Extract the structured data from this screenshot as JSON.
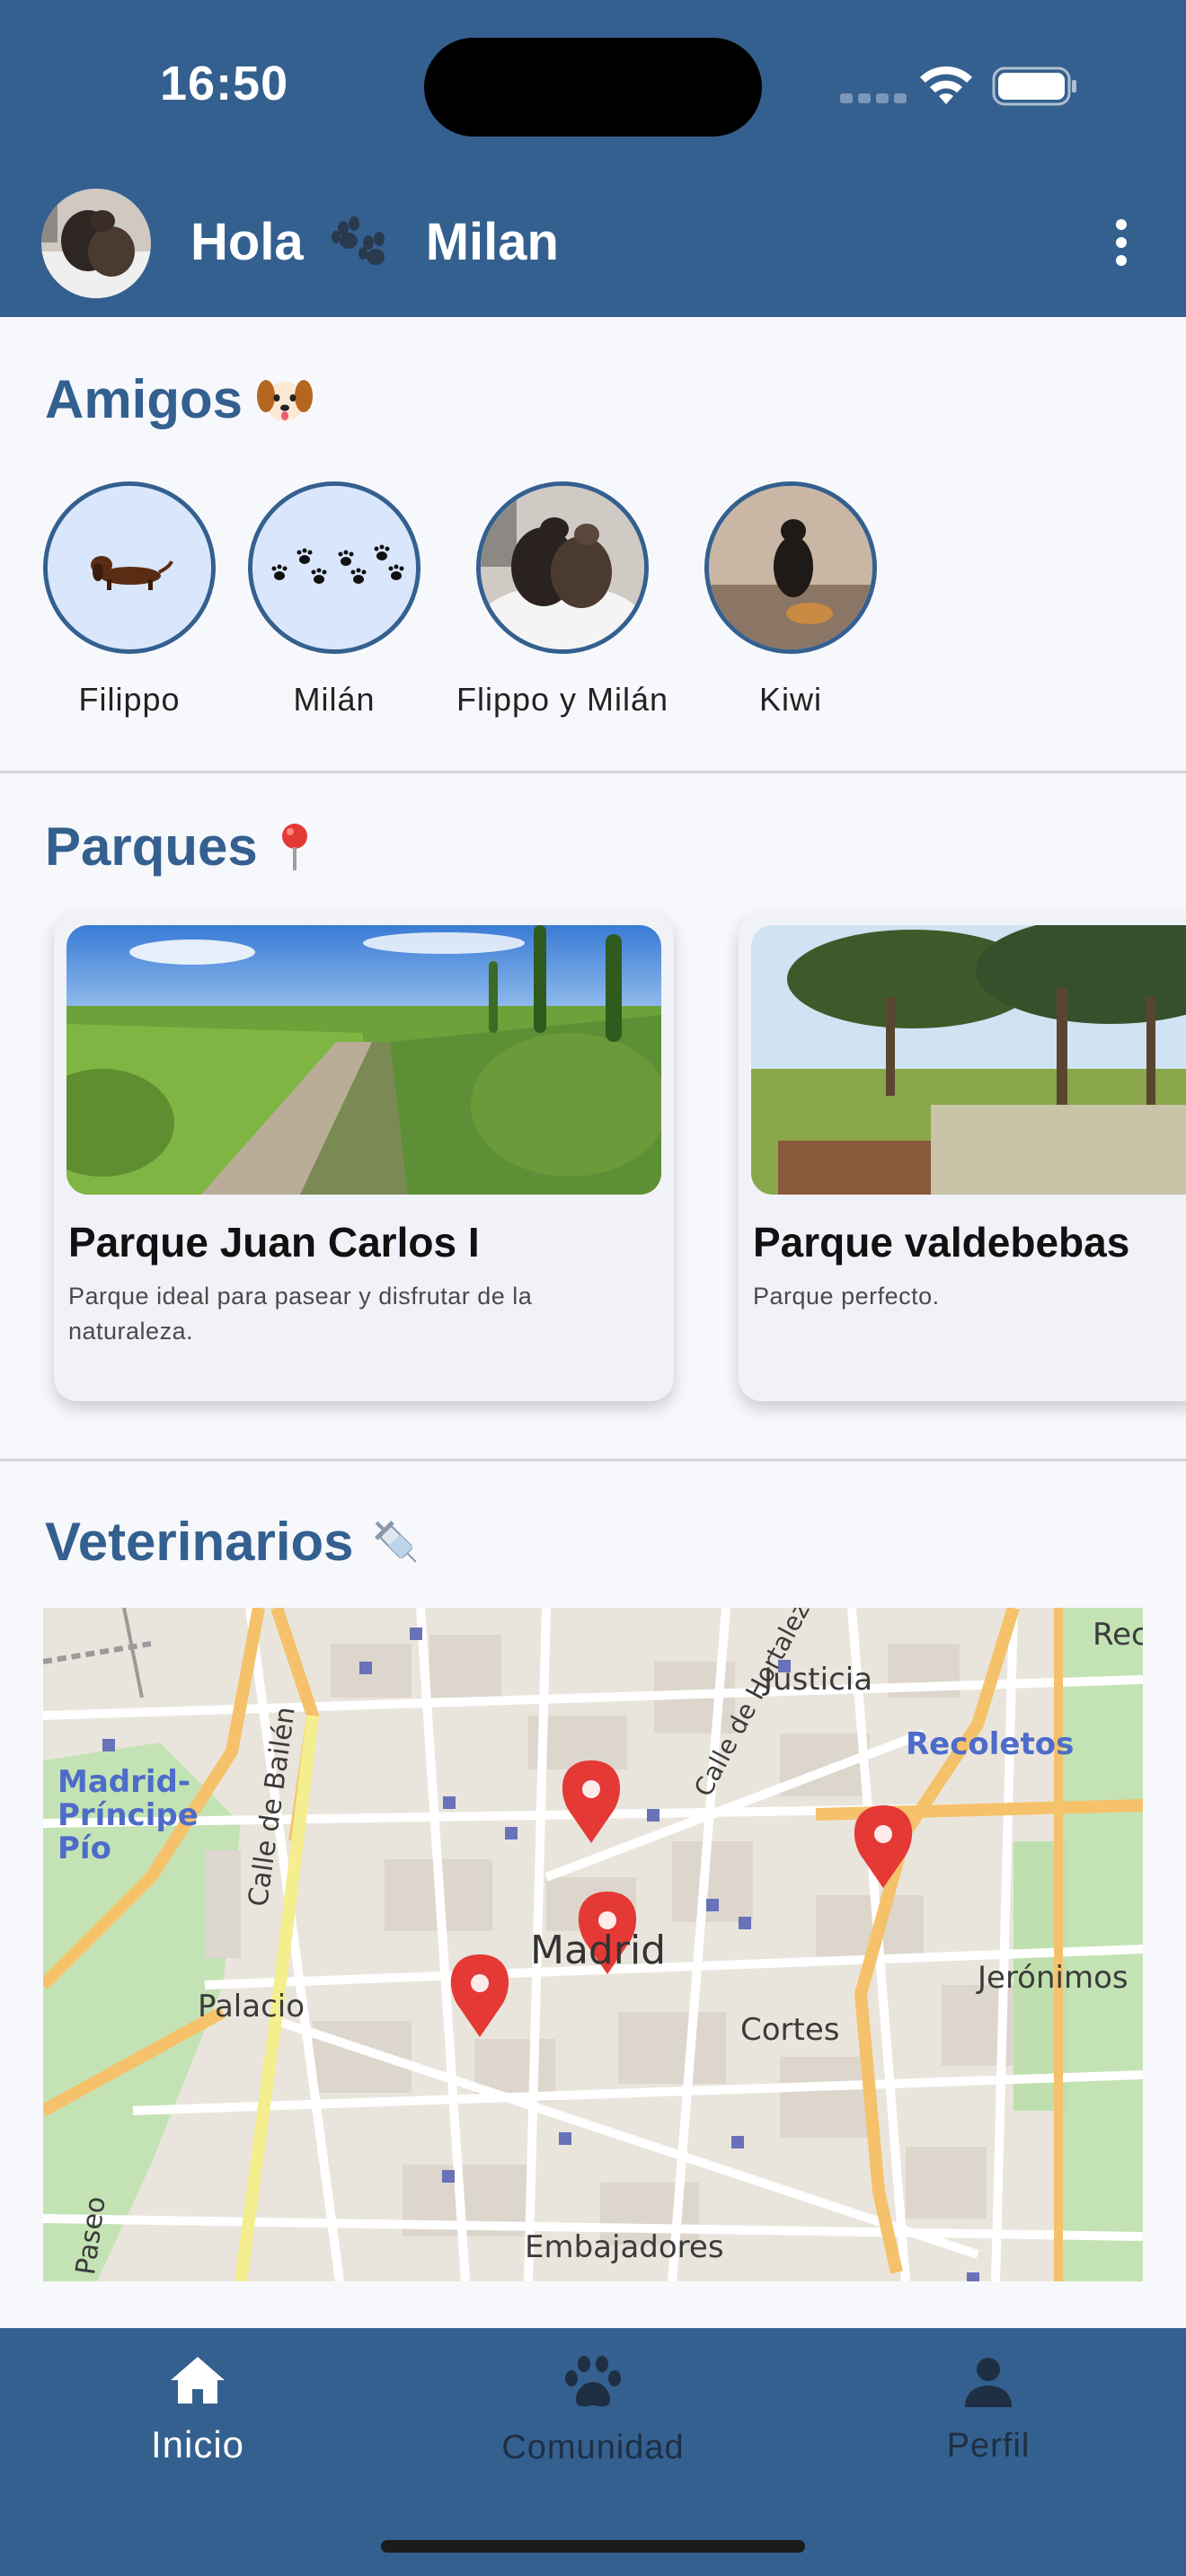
{
  "status_bar": {
    "time": "16:50"
  },
  "header": {
    "greeting": "Hola",
    "user_name": "Milan"
  },
  "friends": {
    "title": "Amigos",
    "items": [
      {
        "name": "Filippo"
      },
      {
        "name": "Milán"
      },
      {
        "name": "Flippo y Milán"
      },
      {
        "name": "Kiwi"
      }
    ]
  },
  "parks": {
    "title": "Parques",
    "items": [
      {
        "name": "Parque Juan Carlos I",
        "description": "Parque ideal para pasear y disfrutar de la naturaleza."
      },
      {
        "name": "Parque valdebebas",
        "description": "Parque perfecto."
      }
    ]
  },
  "vets": {
    "title": "Veterinarios",
    "map_labels": {
      "madrid": "Madrid",
      "justicia": "Justicia",
      "recoletos": "Recoletos",
      "principe_pio": "Madrid-\nPríncipe\nPío",
      "palacio": "Palacio",
      "cortes": "Cortes",
      "jeronimos": "Jerónimos",
      "embajadores": "Embajadores",
      "calle_bailen": "Calle de Bailén",
      "calle_hortaleza": "Calle de Hortaleza",
      "paseo": "Paseo",
      "rec": "Rec"
    }
  },
  "bottom_nav": {
    "items": [
      {
        "label": "Inicio"
      },
      {
        "label": "Comunidad"
      },
      {
        "label": "Perfil"
      }
    ]
  },
  "colors": {
    "primary": "#34608f",
    "pin": "#e53935",
    "background": "#f7f8fc"
  }
}
